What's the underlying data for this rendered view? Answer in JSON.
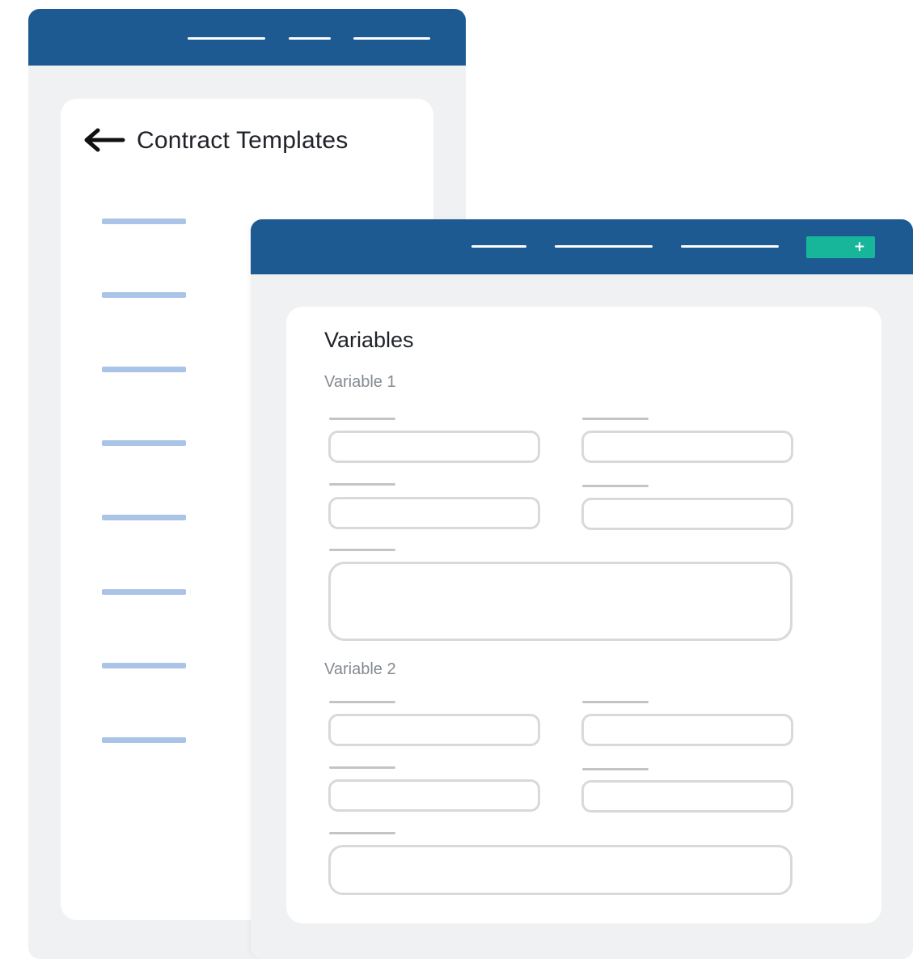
{
  "back_window": {
    "page_title": "Contract Templates",
    "nav_items": 3,
    "list_items": 8
  },
  "front_window": {
    "add_button_icon": "plus-icon",
    "section_title": "Variables",
    "variables": [
      {
        "label": "Variable 1"
      },
      {
        "label": "Variable 2"
      }
    ]
  },
  "colors": {
    "titlebar": "#1d5a91",
    "accent": "#17b59a",
    "list_line": "#a9c4e6"
  }
}
